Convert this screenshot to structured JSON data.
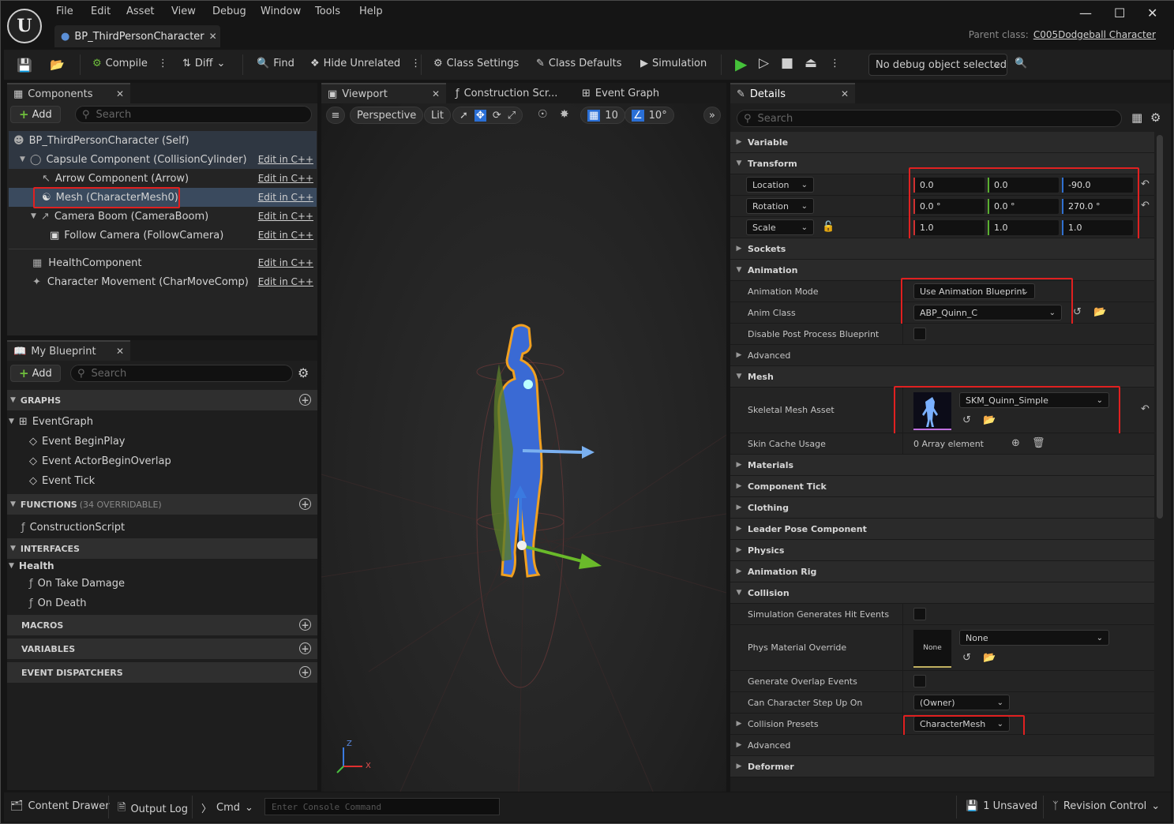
{
  "menu": [
    "File",
    "Edit",
    "Asset",
    "View",
    "Debug",
    "Window",
    "Tools",
    "Help"
  ],
  "document_tab": "BP_ThirdPersonCharacter",
  "parent_class": {
    "label": "Parent class:",
    "value": "C005Dodgeball Character"
  },
  "toolbar": {
    "compile": "Compile",
    "diff": "Diff",
    "find": "Find",
    "hide_unrelated": "Hide Unrelated",
    "class_settings": "Class Settings",
    "class_defaults": "Class Defaults",
    "simulation": "Simulation",
    "debug_object": "No debug object selected"
  },
  "components": {
    "tab": "Components",
    "add": "Add",
    "search_placeholder": "Search",
    "edit_label": "Edit in C++",
    "items": [
      {
        "label": "BP_ThirdPersonCharacter (Self)"
      },
      {
        "label": "Capsule Component (CollisionCylinder)"
      },
      {
        "label": "Arrow Component (Arrow)"
      },
      {
        "label": "Mesh (CharacterMesh0)"
      },
      {
        "label": "Camera Boom (CameraBoom)"
      },
      {
        "label": "Follow Camera (FollowCamera)"
      },
      {
        "label": "HealthComponent"
      },
      {
        "label": "Character Movement (CharMoveComp)"
      }
    ]
  },
  "my_blueprint": {
    "tab": "My Blueprint",
    "add": "Add",
    "search_placeholder": "Search",
    "graphs": "GRAPHS",
    "event_graph": "EventGraph",
    "events": [
      "Event BeginPlay",
      "Event ActorBeginOverlap",
      "Event Tick"
    ],
    "functions": "FUNCTIONS",
    "functions_count": "(34 OVERRIDABLE)",
    "construction_script": "ConstructionScript",
    "interfaces": "INTERFACES",
    "health": "Health",
    "health_items": [
      "On Take Damage",
      "On Death"
    ],
    "macros": "MACROS",
    "variables": "VARIABLES",
    "event_dispatchers": "EVENT DISPATCHERS"
  },
  "viewport": {
    "tabs": [
      "Viewport",
      "Construction Scr...",
      "Event Graph"
    ],
    "perspective": "Perspective",
    "lit": "Lit",
    "grid": "10",
    "angle": "10°",
    "axis_z": "Z",
    "axis_x": "X"
  },
  "details": {
    "tab": "Details",
    "search_placeholder": "Search",
    "variable": "Variable",
    "transform": "Transform",
    "location": {
      "label": "Location",
      "x": "0.0",
      "y": "0.0",
      "z": "-90.0"
    },
    "rotation": {
      "label": "Rotation",
      "x": "0.0 °",
      "y": "0.0 °",
      "z": "270.0 °"
    },
    "scale": {
      "label": "Scale",
      "x": "1.0",
      "y": "1.0",
      "z": "1.0"
    },
    "sockets": "Sockets",
    "animation": "Animation",
    "animation_mode_label": "Animation Mode",
    "animation_mode_value": "Use Animation Blueprint",
    "anim_class_label": "Anim Class",
    "anim_class_value": "ABP_Quinn_C",
    "disable_post_label": "Disable Post Process Blueprint",
    "advanced": "Advanced",
    "mesh": "Mesh",
    "skeletal_mesh_label": "Skeletal Mesh Asset",
    "skeletal_mesh_value": "SKM_Quinn_Simple",
    "skin_cache_label": "Skin Cache Usage",
    "skin_cache_value": "0 Array element",
    "materials": "Materials",
    "component_tick": "Component Tick",
    "clothing": "Clothing",
    "leader_pose": "Leader Pose Component",
    "physics": "Physics",
    "animation_rig": "Animation Rig",
    "collision": "Collision",
    "sim_hit_label": "Simulation Generates Hit Events",
    "phys_mat_label": "Phys Material Override",
    "phys_mat_thumb": "None",
    "phys_mat_value": "None",
    "gen_overlap_label": "Generate Overlap Events",
    "step_up_label": "Can Character Step Up On",
    "step_up_value": "(Owner)",
    "collision_presets_label": "Collision Presets",
    "collision_presets_value": "CharacterMesh",
    "advanced2": "Advanced",
    "deformer": "Deformer"
  },
  "statusbar": {
    "content_drawer": "Content Drawer",
    "output_log": "Output Log",
    "cmd": "Cmd",
    "console_placeholder": "Enter Console Command",
    "unsaved": "1 Unsaved",
    "revision_control": "Revision Control"
  }
}
